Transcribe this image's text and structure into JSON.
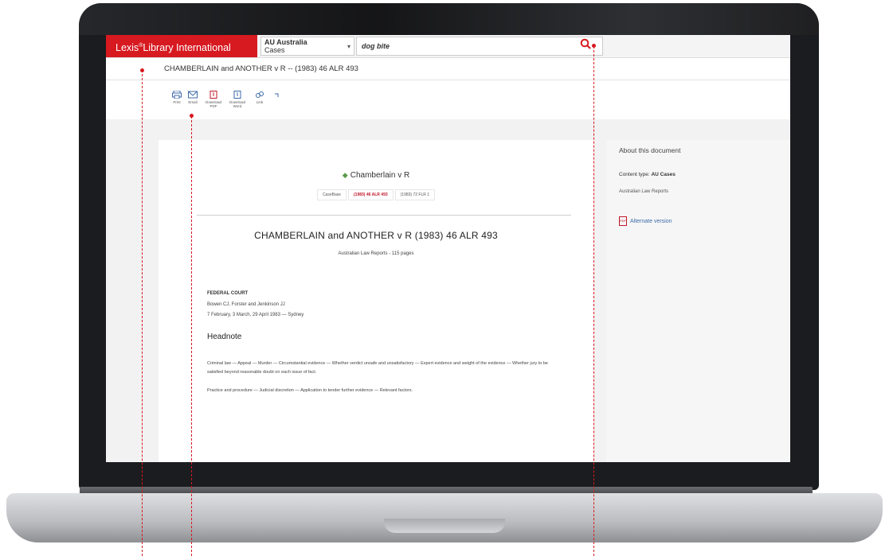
{
  "app": {
    "brand": "Lexis",
    "brand_sup": "®",
    "brand_suffix": "Library International"
  },
  "search": {
    "source_line1": "AU Australia",
    "source_line2": "Cases",
    "query": "dog bite",
    "search_icon": "search-icon"
  },
  "breadcrumb": {
    "heading": "CHAMBERLAIN and ANOTHER v R -- (1983) 46 ALR 493"
  },
  "toolbar": {
    "items": [
      {
        "label": "Print",
        "icon": "printer-icon"
      },
      {
        "label": "Email",
        "icon": "email-icon"
      },
      {
        "label": "Download PDF",
        "icon": "download-pdf-icon"
      },
      {
        "label": "Download Word",
        "icon": "download-word-icon"
      },
      {
        "label": "Link",
        "icon": "link-icon"
      },
      {
        "label": "",
        "icon": "more-icon"
      }
    ]
  },
  "document": {
    "short_title": "Chamberlain v R",
    "citations": [
      "CaseBase",
      "(1983) 46 ALR 493",
      "(1983) 72 FLR 1"
    ],
    "case_name": "CHAMBERLAIN and ANOTHER v R (1983) 46 ALR 493",
    "report_pages": "Australian Law Reports - 115 pages",
    "court": "FEDERAL COURT",
    "judges": "Bowen CJ, Forster and Jenkinson JJ",
    "dates": "7 February, 3 March, 29 April 1983 — Sydney",
    "headnote_heading": "Headnote",
    "headnote_1": "Criminal law — Appeal — Murder — Circumstantial evidence — Whether verdict unsafe and unsatisfactory — Expert evidence and weight of the evidence — Whether jury to be satisfied beyond reasonable doubt on each issue of fact.",
    "headnote_2": "Practice and procedure — Judicial discretion — Application to tender further evidence — Relevant factors."
  },
  "sidebar": {
    "title": "About this document",
    "content_label": "Content type:",
    "content_value": "AU Cases",
    "sub": "Australian Law Reports",
    "alternate": "Alternate version",
    "pdf_icon": "pdf-icon"
  },
  "colors": {
    "brand_red": "#d71920",
    "link_blue": "#3c6aa8",
    "cite_red": "#c0182a"
  }
}
